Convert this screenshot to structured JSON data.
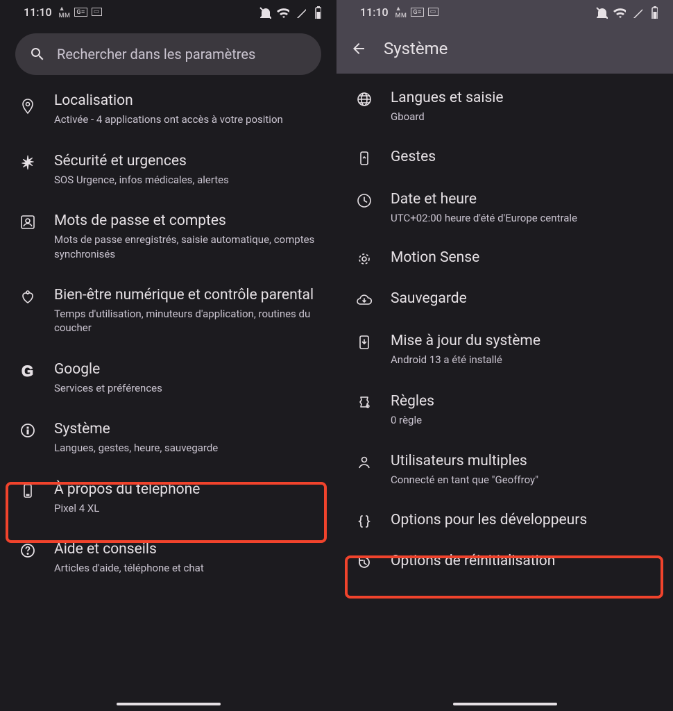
{
  "status": {
    "time": "11:10"
  },
  "left": {
    "search_placeholder": "Rechercher dans les paramètres",
    "items": [
      {
        "icon": "location",
        "title": "Localisation",
        "subtitle": "Activée - 4 applications ont accès à votre position"
      },
      {
        "icon": "asterisk",
        "title": "Sécurité et urgences",
        "subtitle": "SOS Urgence, infos médicales, alertes"
      },
      {
        "icon": "accountbox",
        "title": "Mots de passe et comptes",
        "subtitle": "Mots de passe enregistrés, saisie automatique, comptes synchronisés"
      },
      {
        "icon": "wellbeing",
        "title": "Bien-être numérique et contrôle parental",
        "subtitle": "Temps d'utilisation, minuteurs d'application, routines du coucher"
      },
      {
        "icon": "google",
        "title": "Google",
        "subtitle": "Services et préférences"
      },
      {
        "icon": "info",
        "title": "Système",
        "subtitle": "Langues, gestes, heure, sauvegarde",
        "highlight": true
      },
      {
        "icon": "phonebox",
        "title": "À propos du téléphone",
        "subtitle": "Pixel 4 XL"
      },
      {
        "icon": "help",
        "title": "Aide et conseils",
        "subtitle": "Articles d'aide, téléphone et chat"
      }
    ]
  },
  "right": {
    "title": "Système",
    "items": [
      {
        "icon": "globe",
        "title": "Langues et saisie",
        "subtitle": "Gboard"
      },
      {
        "icon": "gesture",
        "title": "Gestes"
      },
      {
        "icon": "clock",
        "title": "Date et heure",
        "subtitle": "UTC+02:00 heure d'été d'Europe centrale"
      },
      {
        "icon": "motion",
        "title": "Motion Sense"
      },
      {
        "icon": "cloud",
        "title": "Sauvegarde"
      },
      {
        "icon": "download",
        "title": "Mise à jour du système",
        "subtitle": "Android 13 a été installé"
      },
      {
        "icon": "rules",
        "title": "Règles",
        "subtitle": "0 règle"
      },
      {
        "icon": "user",
        "title": "Utilisateurs multiples",
        "subtitle": "Connecté en tant que \"Geoffroy\""
      },
      {
        "icon": "braces",
        "title": "Options pour les développeurs",
        "highlight": true
      },
      {
        "icon": "restore",
        "title": "Options de réinitialisation"
      }
    ]
  }
}
